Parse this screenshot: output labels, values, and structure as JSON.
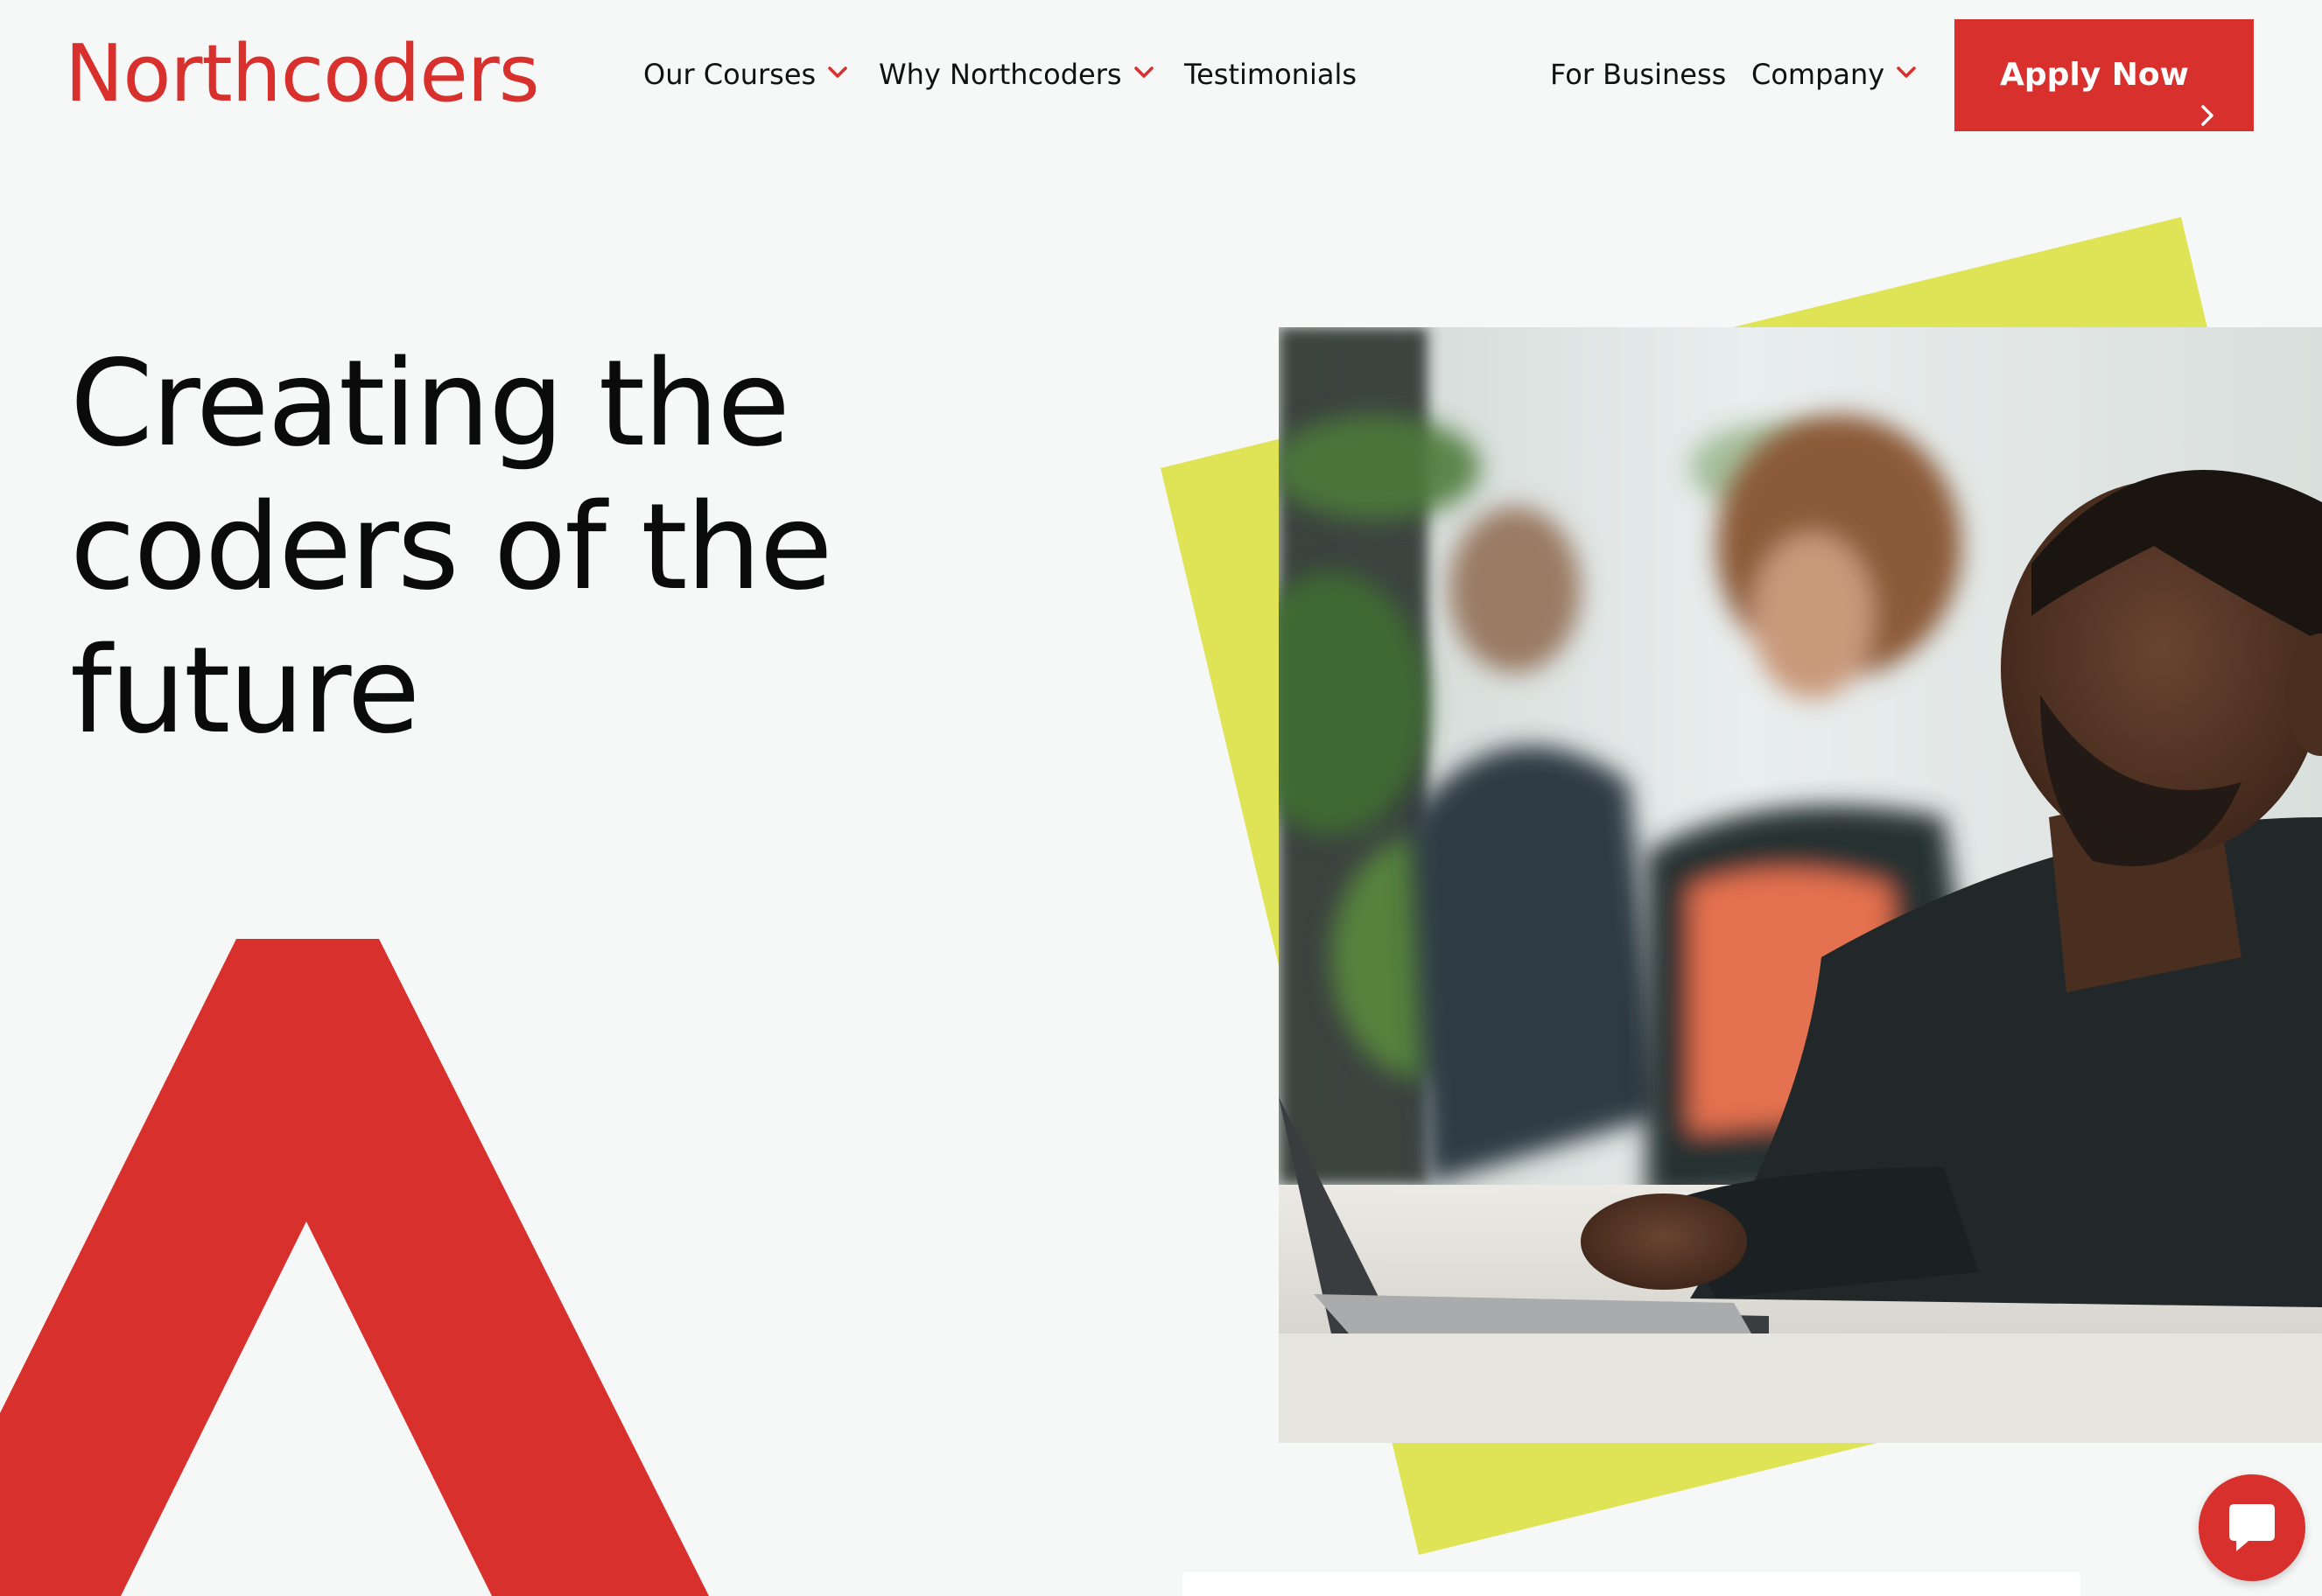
{
  "header": {
    "logo": "Northcoders",
    "nav": [
      {
        "label": "Our Courses",
        "has_dropdown": true
      },
      {
        "label": "Why Northcoders",
        "has_dropdown": true
      },
      {
        "label": "Testimonials",
        "has_dropdown": false
      },
      {
        "label": "For Business",
        "has_dropdown": false
      },
      {
        "label": "Company",
        "has_dropdown": true
      }
    ],
    "cta": "Apply Now"
  },
  "hero": {
    "title": "Creating the coders of the future"
  },
  "colors": {
    "brand_red": "#d7302d",
    "accent_yellow": "#dfe356",
    "background": "#f6f8f7"
  },
  "icons": {
    "chat": "chat-bubble-icon",
    "dropdown": "chevron-down-icon",
    "cta_arrow": "chevron-right-icon"
  }
}
